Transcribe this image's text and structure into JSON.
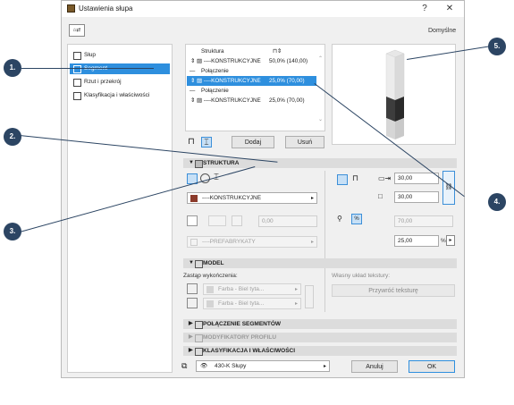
{
  "window": {
    "title": "Ustawienia słupa",
    "help": "?",
    "close": "✕",
    "preset": "Domyślne"
  },
  "sidebar": {
    "items": [
      {
        "label": "Słup"
      },
      {
        "label": "Segment"
      },
      {
        "label": "Rzut i przekrój"
      },
      {
        "label": "Klasyfikacja i właściwości"
      }
    ]
  },
  "structure_list": {
    "header": "Struktura",
    "rows": [
      {
        "label": "----KONSTRUKCYJNE",
        "value": "50,0% (140,00)"
      },
      {
        "label": "Połączenie",
        "value": ""
      },
      {
        "label": "----KONSTRUKCYJNE",
        "value": "25,0% (70,00)"
      },
      {
        "label": "Połączenie",
        "value": ""
      },
      {
        "label": "----KONSTRUKCYJNE",
        "value": "25,0% (70,00)"
      }
    ],
    "add_label": "Dodaj",
    "remove_label": "Usuń"
  },
  "sections": {
    "struktura": "STRUKTURA",
    "model": "MODEL",
    "polaczenie": "POŁĄCZENIE SEGMENTÓW",
    "modyfikatory": "MODYFIKATORY PROFILU",
    "klasyfikacja": "KLASYFIKACJA I WŁAŚCIWOŚCI"
  },
  "struktura": {
    "material": "----KONSTRUKCYJNE",
    "offset_value": "0,00",
    "prefab": "----PREFABRYKATY",
    "width": "30,00",
    "depth": "30,00",
    "height_disabled": "70,00",
    "percent": "25,00",
    "percent_unit": "%"
  },
  "model": {
    "override_label": "Zastąp wykończenia:",
    "finish1": "Farba - Biel tyta...",
    "finish2": "Farba - Biel tyta...",
    "texture_label": "Własny układ tekstury:",
    "texture_button": "Przywróć teksturę"
  },
  "footer": {
    "layer": "430-K Słupy",
    "cancel": "Anuluj",
    "ok": "OK"
  },
  "callouts": [
    "1.",
    "2.",
    "3.",
    "4.",
    "5."
  ],
  "colors": {
    "accent": "#2e8fde",
    "callout": "#2c4563"
  }
}
